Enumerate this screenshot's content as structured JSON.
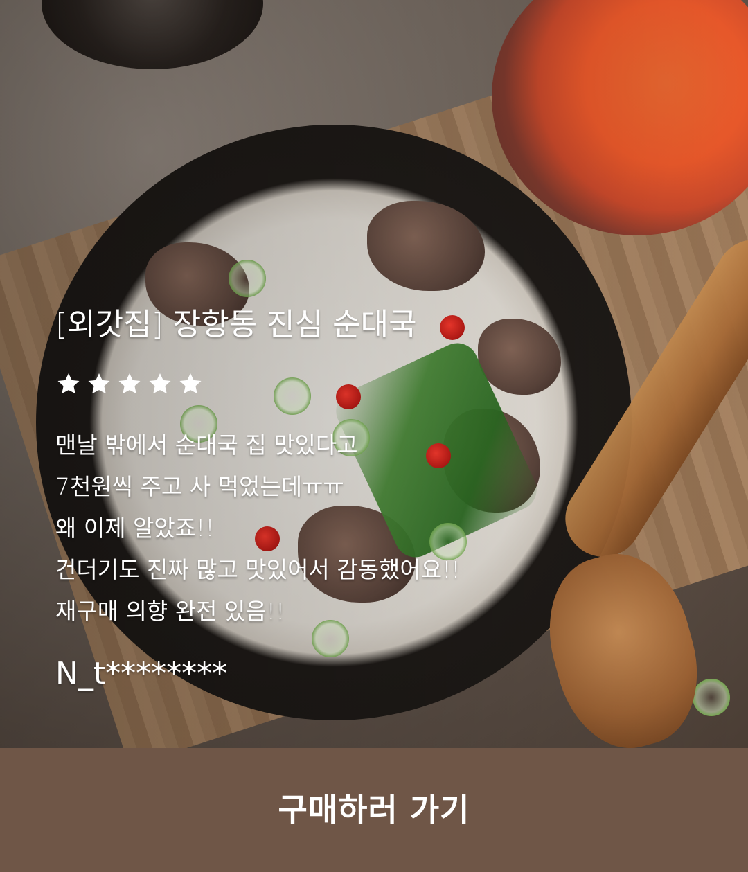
{
  "review": {
    "title": "[외갓집] 장항동 진심 순대국",
    "rating": {
      "value": 5,
      "max": 5
    },
    "lines": [
      "맨날 밖에서 순대국 집 맛있다고",
      "7천원씩 주고 사 먹었는데ㅠㅠ",
      "왜 이제 알았죠!!",
      "건더기도 진짜 많고 맛있어서 감동했어요!!",
      "재구매 의향 완전 있음!!"
    ],
    "reviewer": "N_t********"
  },
  "cta": {
    "label": "구매하러 가기"
  },
  "colors": {
    "cta_background": "#6f5647",
    "text": "#ffffff"
  }
}
